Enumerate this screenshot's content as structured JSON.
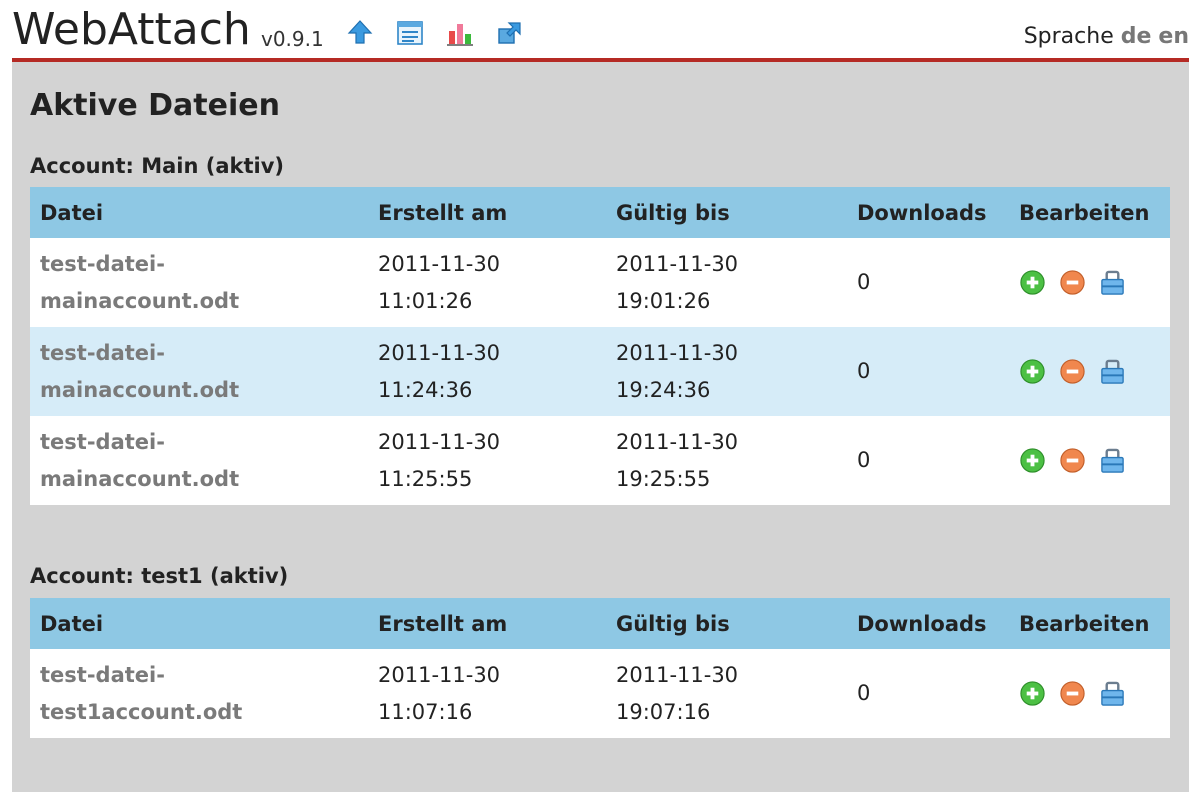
{
  "header": {
    "app_title": "WebAttach",
    "version": "v0.9.1",
    "icons": [
      "upload-icon",
      "list-icon",
      "stats-chart-icon",
      "external-link-icon"
    ],
    "language_label": "Sprache",
    "languages": [
      "de",
      "en"
    ]
  },
  "page_title": "Aktive Dateien",
  "columns": {
    "file": "Datei",
    "created": "Erstellt am",
    "valid_until": "Gültig bis",
    "downloads": "Downloads",
    "edit": "Bearbeiten"
  },
  "accounts": [
    {
      "title": "Account: Main (aktiv)",
      "rows": [
        {
          "file_line1": "test-datei-",
          "file_line2": "mainaccount.odt",
          "created_date": "2011-11-30",
          "created_time": "11:01:26",
          "valid_date": "2011-11-30",
          "valid_time": "19:01:26",
          "downloads": "0"
        },
        {
          "file_line1": "test-datei-",
          "file_line2": "mainaccount.odt",
          "created_date": "2011-11-30",
          "created_time": "11:24:36",
          "valid_date": "2011-11-30",
          "valid_time": "19:24:36",
          "downloads": "0"
        },
        {
          "file_line1": "test-datei-",
          "file_line2": "mainaccount.odt",
          "created_date": "2011-11-30",
          "created_time": "11:25:55",
          "valid_date": "2011-11-30",
          "valid_time": "19:25:55",
          "downloads": "0"
        }
      ]
    },
    {
      "title": "Account: test1 (aktiv)",
      "rows": [
        {
          "file_line1": "test-datei-",
          "file_line2": "test1account.odt",
          "created_date": "2011-11-30",
          "created_time": "11:07:16",
          "valid_date": "2011-11-30",
          "valid_time": "19:07:16",
          "downloads": "0"
        }
      ]
    }
  ],
  "colors": {
    "accent_red": "#b52a24",
    "header_blue": "#8ec8e4",
    "row_alt": "#d6ecf8",
    "panel_grey": "#d3d3d3"
  }
}
